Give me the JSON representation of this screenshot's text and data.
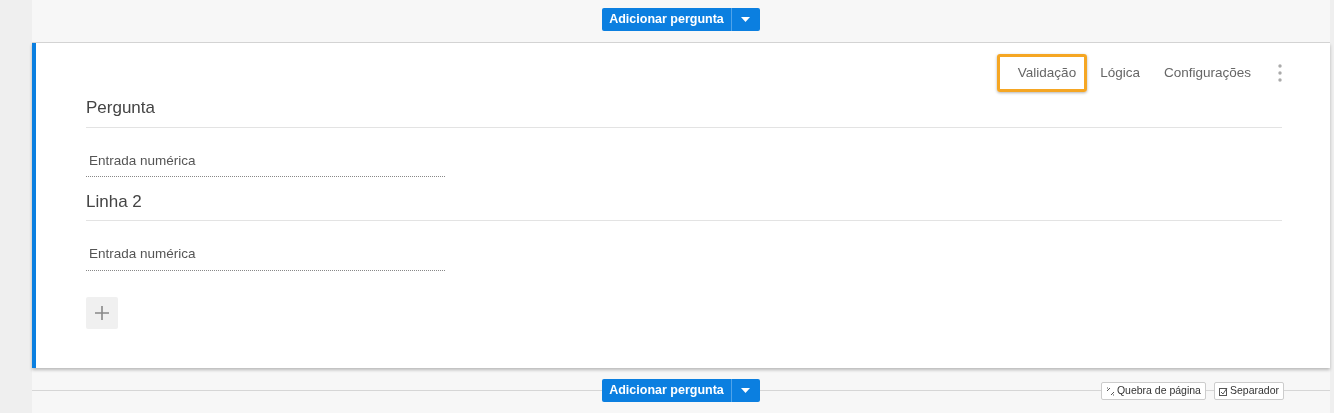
{
  "top_add_button": {
    "label": "Adicionar pergunta"
  },
  "card": {
    "menu": [
      {
        "label": "Validação",
        "highlighted": true
      },
      {
        "label": "Lógica",
        "highlighted": false
      },
      {
        "label": "Configurações",
        "highlighted": false
      }
    ],
    "rows": [
      {
        "title": "Pergunta",
        "placeholder": "Entrada numérica"
      },
      {
        "title": "Linha 2",
        "placeholder": "Entrada numérica"
      }
    ]
  },
  "bottom_add_button": {
    "label": "Adicionar pergunta"
  },
  "page_break_button": {
    "label": "Quebra de página"
  },
  "separator_button": {
    "label": "Separador"
  }
}
